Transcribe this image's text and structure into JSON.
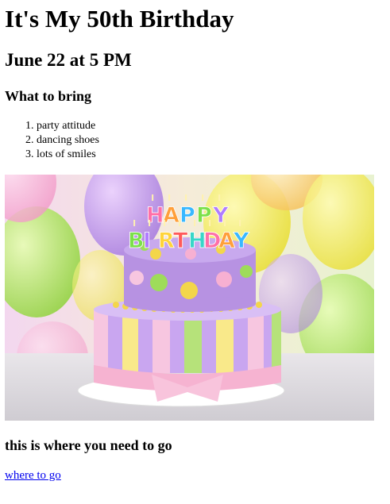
{
  "page": {
    "title": "It's My 50th Birthday",
    "date_time": "June 22 at 5 PM",
    "bring_heading": "What to bring",
    "bring_items": [
      "party attitude",
      "dancing shoes",
      "lots of smiles"
    ],
    "go_heading": "this is where you need to go",
    "link_text": "where to go"
  },
  "image": {
    "candle_letters_top": [
      "H",
      "A",
      "P",
      "P",
      "Y"
    ],
    "candle_letters_bottom": [
      "B",
      "I",
      "R",
      "T",
      "H",
      "D",
      "A",
      "Y"
    ],
    "candle_colors": [
      "#ff6fa8",
      "#ff9f3a",
      "#39b8ff",
      "#7be04a",
      "#b07cff",
      "#ffd43a",
      "#ff5a5a",
      "#38d6c8"
    ]
  }
}
